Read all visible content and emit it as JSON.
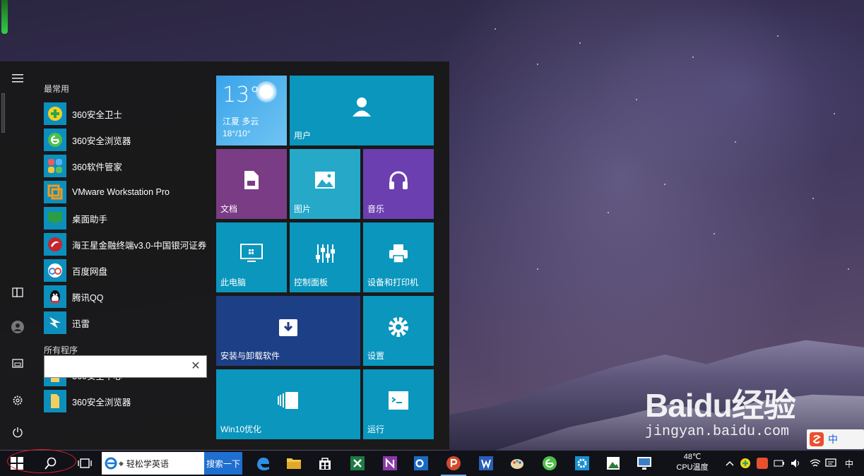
{
  "start_menu": {
    "most_used_title": "最常用",
    "all_programs_title": "所有程序",
    "most_used": [
      {
        "label": "360安全卫士",
        "icon": "360-safe-guard-icon",
        "color": "#2ea44f"
      },
      {
        "label": "360安全浏览器",
        "icon": "360-browser-icon",
        "color": "#2ea44f"
      },
      {
        "label": "360软件管家",
        "icon": "360-software-manager-icon",
        "color": "#f2a73b"
      },
      {
        "label": "VMware Workstation Pro",
        "icon": "vmware-icon",
        "color": "#3b77bf"
      },
      {
        "label": "桌面助手",
        "icon": "desktop-assistant-icon",
        "color": "#2a9d48"
      },
      {
        "label": "海王星金融终端v3.0-中国银河证券",
        "icon": "neptune-finance-icon",
        "color": "#c4262e"
      },
      {
        "label": "百度网盘",
        "icon": "baidu-netdisk-icon",
        "color": "#3a86e8"
      },
      {
        "label": "腾讯QQ",
        "icon": "qq-icon",
        "color": "#111111"
      },
      {
        "label": "迅雷",
        "icon": "xunlei-icon",
        "color": "#2f7de1"
      }
    ],
    "all_programs": [
      {
        "label": "360安全中心",
        "icon": "folder-icon"
      },
      {
        "label": "360安全浏览器",
        "icon": "folder-icon"
      }
    ],
    "search": {
      "value": "",
      "placeholder": ""
    },
    "tiles": {
      "weather": {
        "temp": "13°",
        "location": "江夏  多云",
        "range": "18°/10°"
      },
      "user": "用户",
      "documents": "文档",
      "pictures": "图片",
      "music": "音乐",
      "this_pc": "此电脑",
      "control_panel": "控制面板",
      "devices_printers": "设备和打印机",
      "install_uninstall": "安装与卸载软件",
      "settings": "设置",
      "win10_optimize": "Win10优化",
      "run": "运行"
    }
  },
  "taskbar": {
    "ie_address": "轻松学英语",
    "ie_search_button": "搜索一下",
    "cpu_temp_value": "48℃",
    "cpu_temp_label": "CPU温度",
    "ime_indicator": "中"
  },
  "watermark": {
    "brand_text": "Baidu经验",
    "url": "jingyan.baidu.com"
  },
  "colors": {
    "tile_teal": "#0a96bd",
    "tile_purple": "#7a3c84",
    "tile_cyan": "#26a9c9",
    "tile_violet": "#6b3fb0",
    "tile_navy": "#1d3f86",
    "taskbar": "#101218",
    "start_bg": "#181818"
  }
}
